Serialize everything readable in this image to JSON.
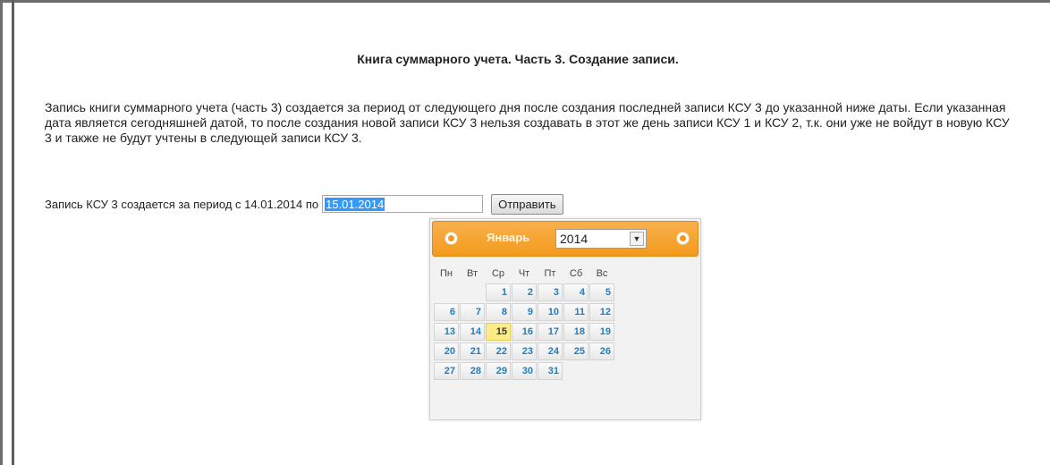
{
  "page": {
    "title": "Книга суммарного учета. Часть 3. Создание записи.",
    "description": "Запись книги суммарного учета (часть 3) создается за период от следующего дня после создания последней записи КСУ 3 до указанной ниже даты. Если указанная дата является сегодняшней датой, то после создания новой записи КСУ 3 нельзя создавать в этот же день записи КСУ 1 и КСУ 2, т.к. они уже не войдут в новую КСУ 3 и также не будут учтены в следующей записи КСУ 3."
  },
  "form": {
    "period_label": "Запись КСУ 3 создается за период с 14.01.2014 по",
    "date_value": "15.01.2014",
    "submit_label": "Отправить"
  },
  "datepicker": {
    "month": "Январь",
    "year": "2014",
    "weekdays": [
      "Пн",
      "Вт",
      "Ср",
      "Чт",
      "Пт",
      "Сб",
      "Вс"
    ],
    "weeks": [
      [
        "",
        "",
        "1",
        "2",
        "3",
        "4",
        "5"
      ],
      [
        "6",
        "7",
        "8",
        "9",
        "10",
        "11",
        "12"
      ],
      [
        "13",
        "14",
        "15",
        "16",
        "17",
        "18",
        "19"
      ],
      [
        "20",
        "21",
        "22",
        "23",
        "24",
        "25",
        "26"
      ],
      [
        "27",
        "28",
        "29",
        "30",
        "31",
        "",
        ""
      ]
    ],
    "selected_day": "15"
  },
  "colors": {
    "header_orange": "#f39a1d",
    "day_link_blue": "#1c7fc0",
    "selected_highlight": "#fbec88",
    "input_selection": "#3399ff"
  }
}
